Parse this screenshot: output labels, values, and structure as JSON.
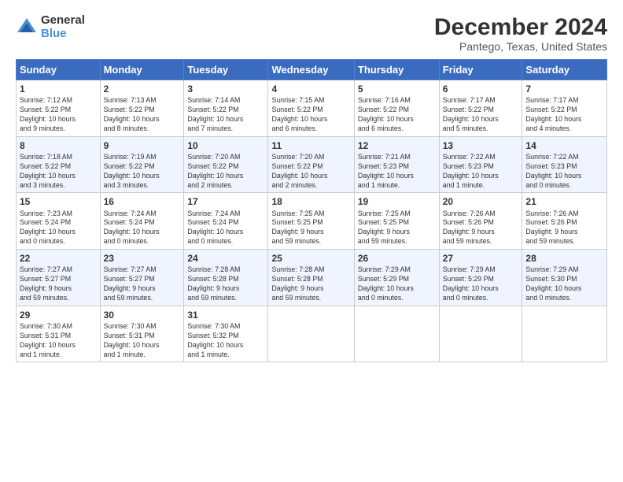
{
  "logo": {
    "general": "General",
    "blue": "Blue"
  },
  "header": {
    "title": "December 2024",
    "subtitle": "Pantego, Texas, United States"
  },
  "weekdays": [
    "Sunday",
    "Monday",
    "Tuesday",
    "Wednesday",
    "Thursday",
    "Friday",
    "Saturday"
  ],
  "weeks": [
    [
      {
        "day": "1",
        "info": "Sunrise: 7:12 AM\nSunset: 5:22 PM\nDaylight: 10 hours\nand 9 minutes."
      },
      {
        "day": "2",
        "info": "Sunrise: 7:13 AM\nSunset: 5:22 PM\nDaylight: 10 hours\nand 8 minutes."
      },
      {
        "day": "3",
        "info": "Sunrise: 7:14 AM\nSunset: 5:22 PM\nDaylight: 10 hours\nand 7 minutes."
      },
      {
        "day": "4",
        "info": "Sunrise: 7:15 AM\nSunset: 5:22 PM\nDaylight: 10 hours\nand 6 minutes."
      },
      {
        "day": "5",
        "info": "Sunrise: 7:16 AM\nSunset: 5:22 PM\nDaylight: 10 hours\nand 6 minutes."
      },
      {
        "day": "6",
        "info": "Sunrise: 7:17 AM\nSunset: 5:22 PM\nDaylight: 10 hours\nand 5 minutes."
      },
      {
        "day": "7",
        "info": "Sunrise: 7:17 AM\nSunset: 5:22 PM\nDaylight: 10 hours\nand 4 minutes."
      }
    ],
    [
      {
        "day": "8",
        "info": "Sunrise: 7:18 AM\nSunset: 5:22 PM\nDaylight: 10 hours\nand 3 minutes."
      },
      {
        "day": "9",
        "info": "Sunrise: 7:19 AM\nSunset: 5:22 PM\nDaylight: 10 hours\nand 3 minutes."
      },
      {
        "day": "10",
        "info": "Sunrise: 7:20 AM\nSunset: 5:22 PM\nDaylight: 10 hours\nand 2 minutes."
      },
      {
        "day": "11",
        "info": "Sunrise: 7:20 AM\nSunset: 5:22 PM\nDaylight: 10 hours\nand 2 minutes."
      },
      {
        "day": "12",
        "info": "Sunrise: 7:21 AM\nSunset: 5:23 PM\nDaylight: 10 hours\nand 1 minute."
      },
      {
        "day": "13",
        "info": "Sunrise: 7:22 AM\nSunset: 5:23 PM\nDaylight: 10 hours\nand 1 minute."
      },
      {
        "day": "14",
        "info": "Sunrise: 7:22 AM\nSunset: 5:23 PM\nDaylight: 10 hours\nand 0 minutes."
      }
    ],
    [
      {
        "day": "15",
        "info": "Sunrise: 7:23 AM\nSunset: 5:24 PM\nDaylight: 10 hours\nand 0 minutes."
      },
      {
        "day": "16",
        "info": "Sunrise: 7:24 AM\nSunset: 5:24 PM\nDaylight: 10 hours\nand 0 minutes."
      },
      {
        "day": "17",
        "info": "Sunrise: 7:24 AM\nSunset: 5:24 PM\nDaylight: 10 hours\nand 0 minutes."
      },
      {
        "day": "18",
        "info": "Sunrise: 7:25 AM\nSunset: 5:25 PM\nDaylight: 9 hours\nand 59 minutes."
      },
      {
        "day": "19",
        "info": "Sunrise: 7:25 AM\nSunset: 5:25 PM\nDaylight: 9 hours\nand 59 minutes."
      },
      {
        "day": "20",
        "info": "Sunrise: 7:26 AM\nSunset: 5:26 PM\nDaylight: 9 hours\nand 59 minutes."
      },
      {
        "day": "21",
        "info": "Sunrise: 7:26 AM\nSunset: 5:26 PM\nDaylight: 9 hours\nand 59 minutes."
      }
    ],
    [
      {
        "day": "22",
        "info": "Sunrise: 7:27 AM\nSunset: 5:27 PM\nDaylight: 9 hours\nand 59 minutes."
      },
      {
        "day": "23",
        "info": "Sunrise: 7:27 AM\nSunset: 5:27 PM\nDaylight: 9 hours\nand 59 minutes."
      },
      {
        "day": "24",
        "info": "Sunrise: 7:28 AM\nSunset: 5:28 PM\nDaylight: 9 hours\nand 59 minutes."
      },
      {
        "day": "25",
        "info": "Sunrise: 7:28 AM\nSunset: 5:28 PM\nDaylight: 9 hours\nand 59 minutes."
      },
      {
        "day": "26",
        "info": "Sunrise: 7:29 AM\nSunset: 5:29 PM\nDaylight: 10 hours\nand 0 minutes."
      },
      {
        "day": "27",
        "info": "Sunrise: 7:29 AM\nSunset: 5:29 PM\nDaylight: 10 hours\nand 0 minutes."
      },
      {
        "day": "28",
        "info": "Sunrise: 7:29 AM\nSunset: 5:30 PM\nDaylight: 10 hours\nand 0 minutes."
      }
    ],
    [
      {
        "day": "29",
        "info": "Sunrise: 7:30 AM\nSunset: 5:31 PM\nDaylight: 10 hours\nand 1 minute."
      },
      {
        "day": "30",
        "info": "Sunrise: 7:30 AM\nSunset: 5:31 PM\nDaylight: 10 hours\nand 1 minute."
      },
      {
        "day": "31",
        "info": "Sunrise: 7:30 AM\nSunset: 5:32 PM\nDaylight: 10 hours\nand 1 minute."
      },
      null,
      null,
      null,
      null
    ]
  ]
}
